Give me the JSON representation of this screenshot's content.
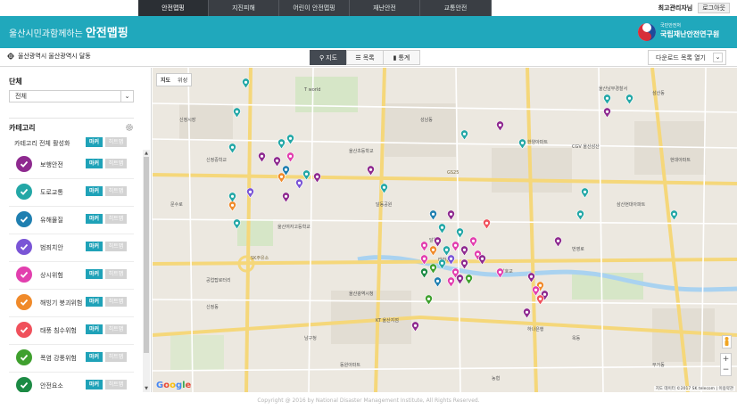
{
  "nav": {
    "items": [
      "안전맵핑",
      "지진피해",
      "어린이 안전맵핑",
      "재난안전",
      "교통안전"
    ],
    "admin_label": "최고관리자님",
    "logout_label": "로그아웃"
  },
  "header": {
    "title_prefix": "울산시민과함께하는",
    "title_main": "안전맵핑",
    "org_sub": "국민안전처",
    "org_name": "국립재난안전연구원"
  },
  "toolbar": {
    "location": "울산광역시 울산광역시 달동",
    "tabs": [
      {
        "label": "지도",
        "icon": "map-pin-icon"
      },
      {
        "label": "목록",
        "icon": "list-icon"
      },
      {
        "label": "통계",
        "icon": "bar-chart-icon"
      }
    ],
    "download_label": "다운로드 목록 열기"
  },
  "sidebar": {
    "group_label": "단체",
    "group_value": "전체",
    "category_label": "카테고리",
    "all_label": "카테고리 전체 활성화",
    "marker_label": "마커",
    "heatmap_label": "히트맵",
    "categories": [
      {
        "name": "보행안전",
        "color": "#8e2a8f"
      },
      {
        "name": "도로교통",
        "color": "#23a7a6"
      },
      {
        "name": "유해물질",
        "color": "#1f7fb0"
      },
      {
        "name": "범죄치안",
        "color": "#7a55d6"
      },
      {
        "name": "상시위험",
        "color": "#e23fae"
      },
      {
        "name": "해빙기 붕괴위험",
        "color": "#f08a2a"
      },
      {
        "name": "태풍 침수위험",
        "color": "#f0515c"
      },
      {
        "name": "폭염 강풍위험",
        "color": "#3fa02e"
      },
      {
        "name": "안전요소",
        "color": "#1c8a44"
      }
    ]
  },
  "map": {
    "toggle": [
      "지도",
      "위성"
    ],
    "google_label": "Google",
    "attribution": "지도 데이터 ©2017 SK telecom | 이용약관",
    "labels": [
      "T world",
      "울산초등학교",
      "신정중학교",
      "울산여자고등학교",
      "성남동",
      "달동",
      "삼산동",
      "GS25",
      "SK주유소",
      "울산광역시청",
      "공업탑로터리",
      "태화강",
      "신정동",
      "옥동",
      "무거동",
      "삼산현대아파트",
      "한양아파트",
      "달동공원",
      "문수로",
      "남구청",
      "CGV 울산삼산",
      "삼호교",
      "하나은행",
      "동원아파트",
      "농협",
      "울산남부경찰서",
      "번영로",
      "신정시장",
      "KT 울산지점",
      "현대아파트"
    ]
  },
  "footer": {
    "copyright": "Copyright @ 2016 by National Disaster Management Institute, All Rights Reserved."
  }
}
